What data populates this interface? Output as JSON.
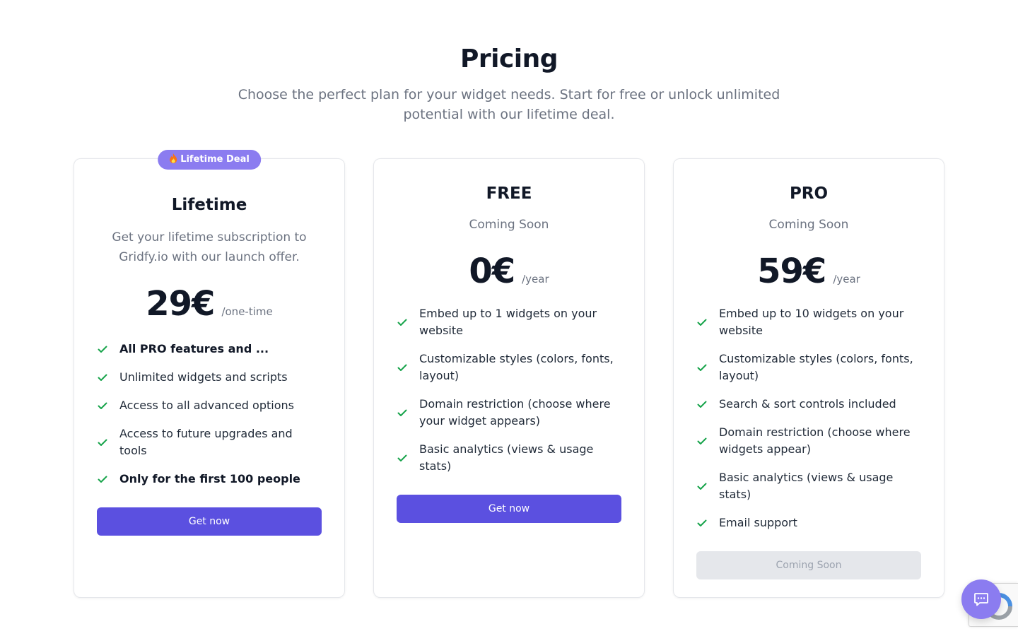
{
  "header": {
    "title": "Pricing",
    "subtitle": "Choose the perfect plan for your widget needs. Start for free or unlock unlimited potential with our lifetime deal."
  },
  "plans": [
    {
      "badge": "Lifetime Deal",
      "badge_icon": "fire-icon",
      "name": "Lifetime",
      "description": "Get your lifetime subscription to Gridfy.io with our launch offer.",
      "price": "29€",
      "period": "/one-time",
      "features": [
        "All PRO features and ...",
        "Unlimited widgets and scripts",
        "Access to all advanced options",
        "Access to future upgrades and tools",
        "Only for the first 100 people"
      ],
      "cta": "Get now"
    },
    {
      "name": "FREE",
      "description": "Coming Soon",
      "price": "0€",
      "period": "/year",
      "features": [
        "Embed up to 1 widgets on your website",
        "Customizable styles (colors, fonts, layout)",
        "Domain restriction (choose where your widget appears)",
        "Basic analytics (views & usage stats)"
      ],
      "cta": "Get now"
    },
    {
      "name": "PRO",
      "description": "Coming Soon",
      "price": "59€",
      "period": "/year",
      "features": [
        "Embed up to 10 widgets on your website",
        "Customizable styles (colors, fonts, layout)",
        "Search & sort controls included",
        "Domain restriction (choose where widgets appear)",
        "Basic analytics (views & usage stats)",
        "Email support"
      ],
      "cta": "Coming Soon"
    }
  ],
  "colors": {
    "primary": "#5b50e0",
    "badge": "#8b7cf0",
    "check": "#16a34a",
    "muted_text": "#6b7280",
    "disabled_bg": "#e5e7eb"
  },
  "widgets": {
    "chat_icon": "chat-icon",
    "recaptcha_icon": "recaptcha-icon"
  }
}
